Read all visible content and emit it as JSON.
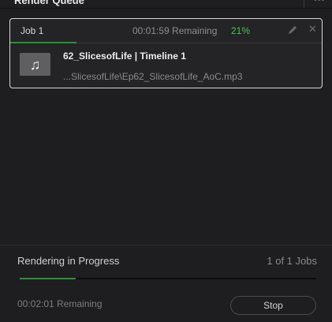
{
  "panel": {
    "title": "Render Queue"
  },
  "job": {
    "label": "Job 1",
    "remaining": "00:01:59 Remaining",
    "percent": "21%",
    "progress": 0.21,
    "clip_title": "62_SlicesofLife | Timeline 1",
    "clip_path": "...SlicesofLife\\Ep62_SlicesofLife_AoC.mp3",
    "thumb_icon": "music-note-icon"
  },
  "footer": {
    "status": "Rendering in Progress",
    "jobs_count": "1 of 1 Jobs",
    "progress": 0.19,
    "remaining": "00:02:01 Remaining",
    "stop_label": "Stop"
  },
  "colors": {
    "accent_green": "#4cc14c",
    "progress_green": "#2f8f3a",
    "background": "#1e1e20",
    "card_border": "#d8d8d8"
  }
}
